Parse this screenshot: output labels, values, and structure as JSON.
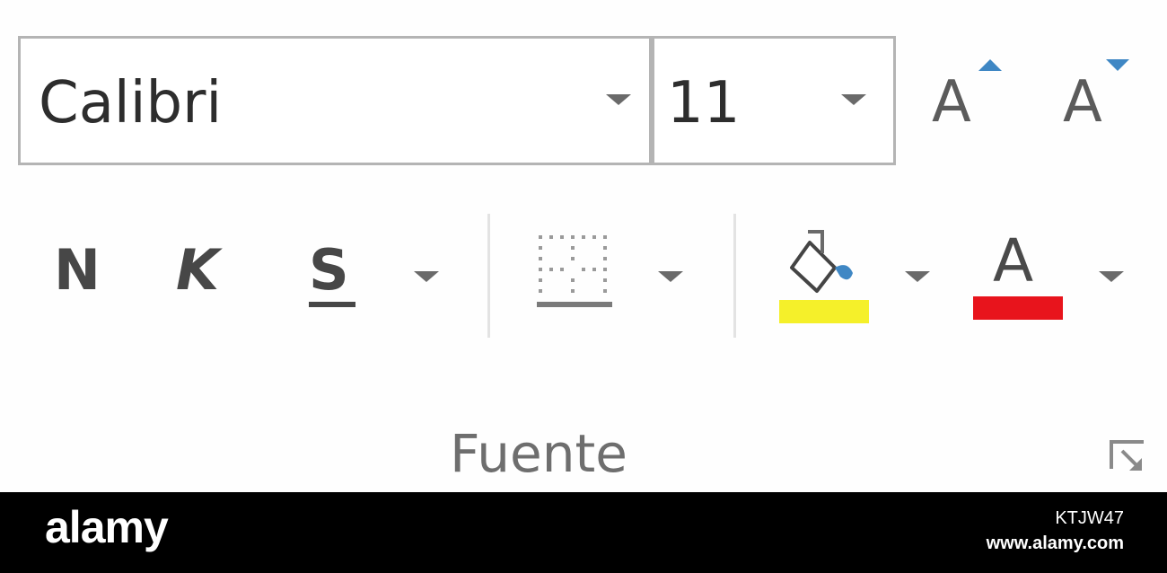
{
  "font_group": {
    "font_name": {
      "value": "Calibri"
    },
    "font_size": {
      "value": "11"
    },
    "grow_font": {
      "glyph": "A",
      "icon": "increase-font-size-icon"
    },
    "shrink_font": {
      "glyph": "A",
      "icon": "decrease-font-size-icon"
    },
    "bold": {
      "glyph": "N"
    },
    "italic": {
      "glyph": "K"
    },
    "underline": {
      "glyph": "S"
    },
    "font_color": {
      "glyph": "A",
      "color": "#e8141c"
    },
    "fill_color": {
      "color": "#f5f02a"
    },
    "label": "Fuente",
    "accent": "#3f87c4"
  },
  "watermark": {
    "logo": "alamy",
    "image_id": "KTJW47",
    "url": "www.alamy.com"
  }
}
